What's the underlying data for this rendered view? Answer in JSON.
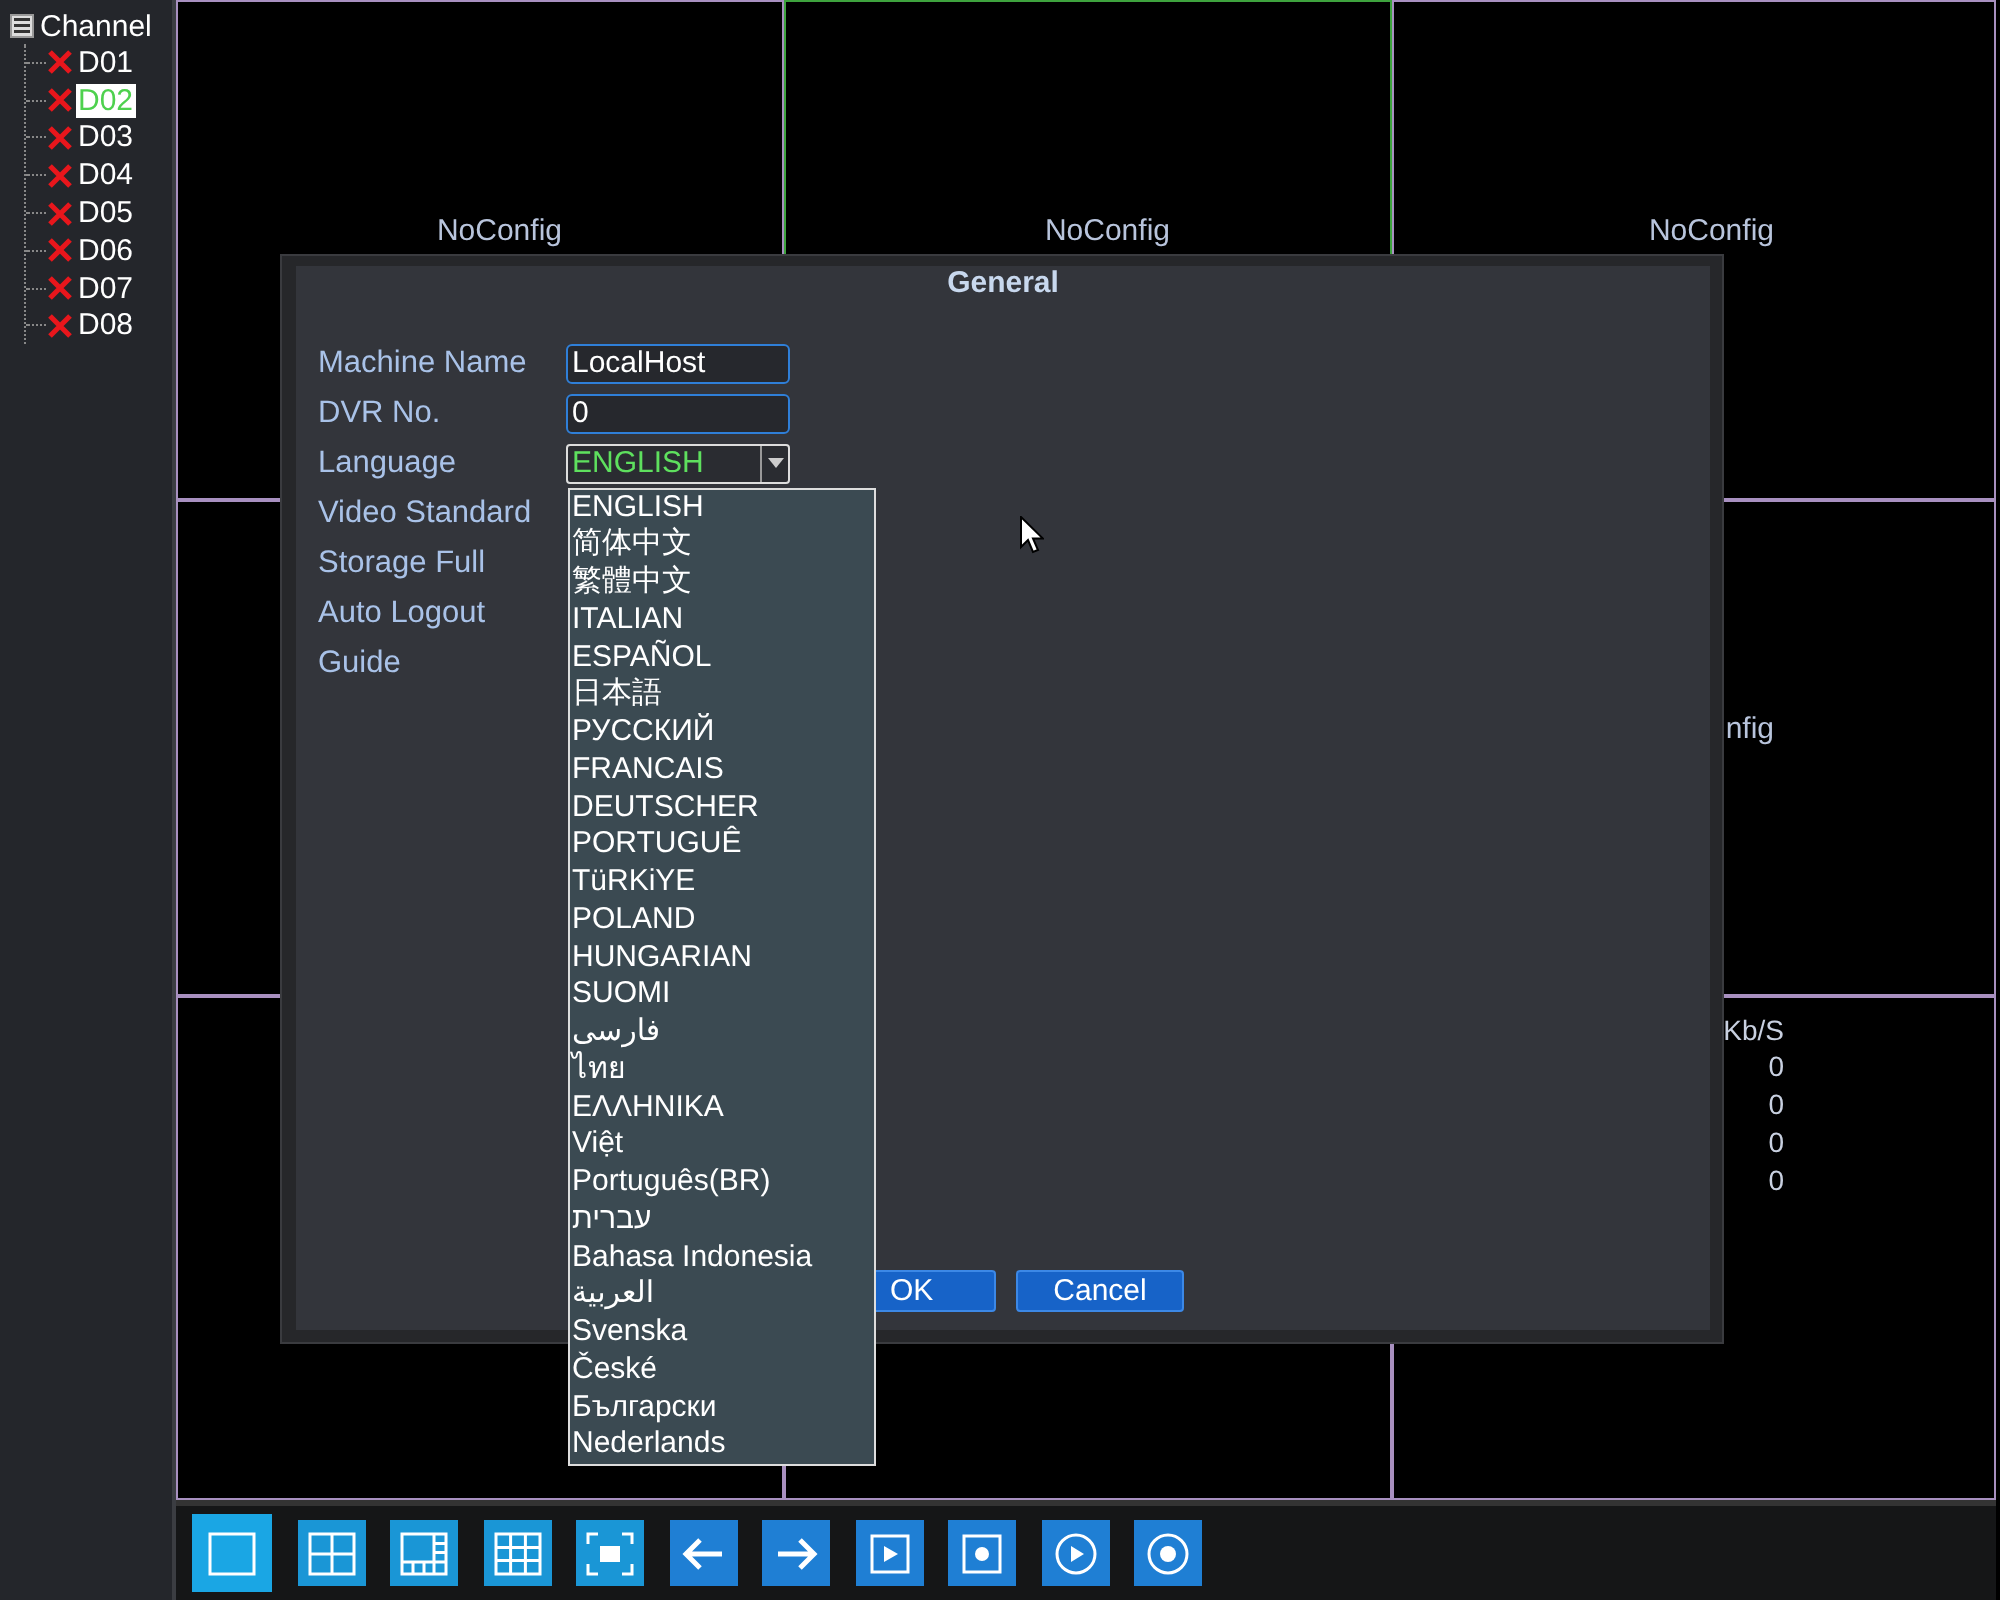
{
  "sidebar": {
    "title": "Channel",
    "channels": [
      {
        "label": "D01",
        "selected": false
      },
      {
        "label": "D02",
        "selected": true
      },
      {
        "label": "D03",
        "selected": false
      },
      {
        "label": "D04",
        "selected": false
      },
      {
        "label": "D05",
        "selected": false
      },
      {
        "label": "D06",
        "selected": false
      },
      {
        "label": "D07",
        "selected": false
      },
      {
        "label": "D08",
        "selected": false
      }
    ]
  },
  "video_grid": {
    "cells": [
      {
        "label": "NoConfig",
        "selected": false
      },
      {
        "label": "NoConfig",
        "selected": true
      },
      {
        "label": "NoConfig",
        "selected": false
      },
      {
        "selected": false
      },
      {},
      {
        "label": "nfig",
        "selected": false
      },
      {
        "selected": false
      },
      {
        "selected": false
      },
      {
        "selected": false,
        "bitrate": {
          "header": "Kb/S",
          "values": [
            "0",
            "0",
            "0",
            "0"
          ]
        }
      }
    ]
  },
  "dialog": {
    "title": "General",
    "fields": [
      {
        "label": "Machine Name",
        "kind": "text",
        "value": "LocalHost"
      },
      {
        "label": "DVR No.",
        "kind": "text",
        "value": "0"
      },
      {
        "label": "Language",
        "kind": "select",
        "value": "ENGLISH",
        "expanded": true,
        "options": [
          "ENGLISH",
          "简体中文",
          "繁體中文",
          "ITALIAN",
          "ESPAÑOL",
          "日本語",
          "РУССКИЙ",
          "FRANCAIS",
          "DEUTSCHER",
          "PORTUGUÊ",
          "TüRKiYE",
          "POLAND",
          "HUNGARIAN",
          "SUOMI",
          "فارسی",
          "ไทย",
          "ΕΛΛΗΝΙΚΑ",
          "Việt",
          "Português(BR)",
          "עברית",
          "Bahasa Indonesia",
          "العربية",
          "Svenska",
          "České",
          "Български",
          "Nederlands"
        ]
      },
      {
        "label": "Video Standard"
      },
      {
        "label": "Storage Full"
      },
      {
        "label": "Auto Logout"
      },
      {
        "label": "Guide"
      }
    ],
    "buttons": [
      "OK",
      "Cancel"
    ]
  },
  "toolbar": [
    {
      "kind": "layout",
      "selected": true
    },
    {
      "kind": "layout",
      "selected": false
    },
    {
      "kind": "layout",
      "selected": false
    },
    {
      "kind": "layout",
      "selected": false
    },
    {
      "kind": "layout",
      "selected": false
    },
    {
      "kind": "control",
      "selected": false
    },
    {
      "kind": "control",
      "selected": false
    },
    {
      "kind": "control",
      "selected": false
    },
    {
      "kind": "control",
      "selected": false
    },
    {
      "kind": "control",
      "selected": false
    },
    {
      "kind": "control",
      "selected": false
    }
  ]
}
